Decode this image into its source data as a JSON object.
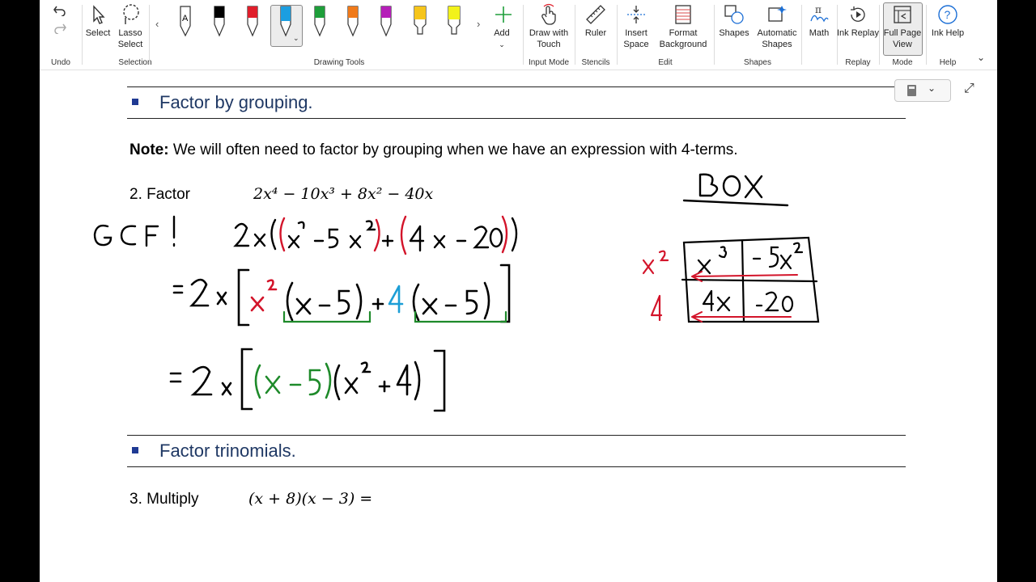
{
  "ribbon": {
    "undo": {
      "label": "Undo",
      "group": "Undo"
    },
    "selection": {
      "group": "Selection",
      "select": "Select",
      "lasso": "Lasso Select"
    },
    "drawing_tools": {
      "group": "Drawing Tools",
      "add": "Add",
      "pens": [
        "pencil-A",
        "pen-black",
        "pen-red",
        "pen-blue",
        "pen-green",
        "pen-orange",
        "pen-purple",
        "highlighter-yellow",
        "highlighter-lime"
      ]
    },
    "input_mode": {
      "group": "Input Mode",
      "draw_touch": "Draw with Touch"
    },
    "stencils": {
      "group": "Stencils",
      "ruler": "Ruler"
    },
    "edit": {
      "group": "Edit",
      "insert_space": "Insert Space",
      "format_background": "Format Background"
    },
    "shapes": {
      "group": "Shapes",
      "shapes": "Shapes",
      "auto_shapes": "Automatic Shapes"
    },
    "math": {
      "label": "Math"
    },
    "replay": {
      "group": "Replay",
      "ink_replay": "Ink Replay"
    },
    "mode": {
      "group": "Mode",
      "full_page": "Full Page View"
    },
    "help": {
      "group": "Help",
      "ink_help": "Ink Help"
    }
  },
  "page": {
    "heading1": "Factor by grouping.",
    "note_label": "Note:",
    "note_text": " We will often need to factor by grouping when we have an expression with 4-terms.",
    "problem2_label": "2. Factor",
    "problem2_expr": "2x⁴ − 10x³ + 8x² − 40x",
    "heading2": "Factor trinomials.",
    "problem3_label": "3. Multiply",
    "problem3_expr": "(x + 8)(x − 3) ="
  },
  "ink": {
    "gcf": "GCF!",
    "line1": "2x((x³ − 5x²) + (4x − 20))",
    "line2": "= 2x[x²(x − 5) + 4(x − 5)]",
    "line3": "= 2x[(x − 5)(x² + 4)]",
    "box_title": "Box",
    "box_rows": [
      "x²",
      "4"
    ],
    "box_cells": [
      [
        "x³",
        "−5x²"
      ],
      [
        "4x",
        "−20"
      ]
    ]
  }
}
